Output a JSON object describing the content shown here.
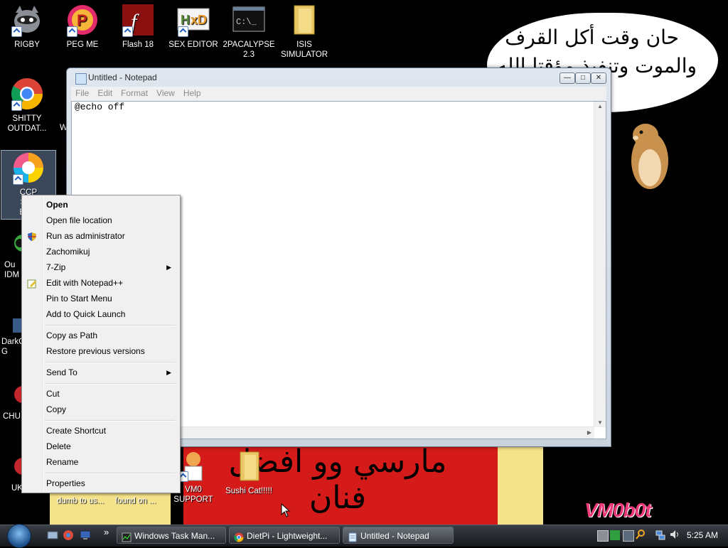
{
  "desktop": {
    "icons": [
      {
        "label": "RIGBY"
      },
      {
        "label": "PEG ME"
      },
      {
        "label": "Flash 18"
      },
      {
        "label": "SEX EDITOR"
      },
      {
        "label": "2PACALYPSE\n2.3"
      },
      {
        "label": "ISIS\nSIMULATOR"
      },
      {
        "label": "SHITTY\nOUTDAT..."
      },
      {
        "label": "CCP\nSPY\nBRO"
      },
      {
        "label": "Ou\nIDM"
      },
      {
        "label": "DarkC\nG"
      },
      {
        "label": "CHU"
      },
      {
        "label": "UKRAINE"
      },
      {
        "label": "VM0\nSUPPORT"
      },
      {
        "label": "Sushi Cat!!!!!"
      }
    ],
    "partial_labels": [
      "dumb to us...",
      "found on ...",
      "W"
    ],
    "bubble_text_line1": "حان وقت أكل القرف",
    "bubble_text_line2": "والموت وتنفيذ مؤقتا الله",
    "banner_text": "مارسي وو افضل فنان",
    "watermark": "VM0b0t"
  },
  "notepad": {
    "title": "Untitled - Notepad",
    "menu": [
      "File",
      "Edit",
      "Format",
      "View",
      "Help"
    ],
    "content": "@echo off"
  },
  "context_menu": {
    "items": [
      {
        "label": "Open",
        "bold": true
      },
      {
        "label": "Open file location"
      },
      {
        "label": "Run as administrator",
        "icon": "shield-icon"
      },
      {
        "label": "Zachomikuj"
      },
      {
        "label": "7-Zip",
        "submenu": true
      },
      {
        "label": "Edit with Notepad++",
        "icon": "notepad-plus-icon"
      },
      {
        "label": "Pin to Start Menu"
      },
      {
        "label": "Add to Quick Launch"
      },
      {
        "label": "Copy as Path"
      },
      {
        "label": "Restore previous versions"
      },
      {
        "label": "Send To",
        "submenu": true
      },
      {
        "label": "Cut"
      },
      {
        "label": "Copy"
      },
      {
        "label": "Create Shortcut"
      },
      {
        "label": "Delete"
      },
      {
        "label": "Rename"
      },
      {
        "label": "Properties"
      }
    ]
  },
  "taskbar": {
    "buttons": [
      {
        "label": "Windows Task Man..."
      },
      {
        "label": "DietPi - Lightweight..."
      },
      {
        "label": "Untitled - Notepad"
      }
    ],
    "clock": "5:25 AM",
    "overflow_chevron": "»"
  }
}
